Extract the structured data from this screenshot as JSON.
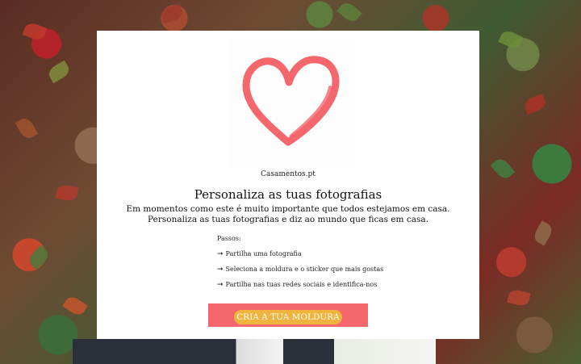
{
  "background": {
    "image": "ivy-wall-wedding-photo"
  },
  "card": {
    "illustration": "heart-icon",
    "heart_color": "#f4676d",
    "brand": "Casamentos.pt",
    "title": "Personaliza as tuas fotografias",
    "description": "Em momentos como este é muito importante que todos estejamos em casa. Personaliza as tuas fotografias e diz ao mundo que ficas em casa.",
    "steps_title": "Passos:",
    "steps": [
      {
        "arrow": "➞",
        "text": "Partilha uma fotografia"
      },
      {
        "arrow": "➞",
        "text": "Seleciona a moldura e o sticker que mais gostas"
      },
      {
        "arrow": "➞",
        "text": "Partilha nas tuas redes sociais e identifica-nos"
      }
    ],
    "cta": {
      "label": "CRIA A TUA MOLDURA",
      "button_color": "#f4676d",
      "label_highlight": "#f0b43e"
    }
  }
}
